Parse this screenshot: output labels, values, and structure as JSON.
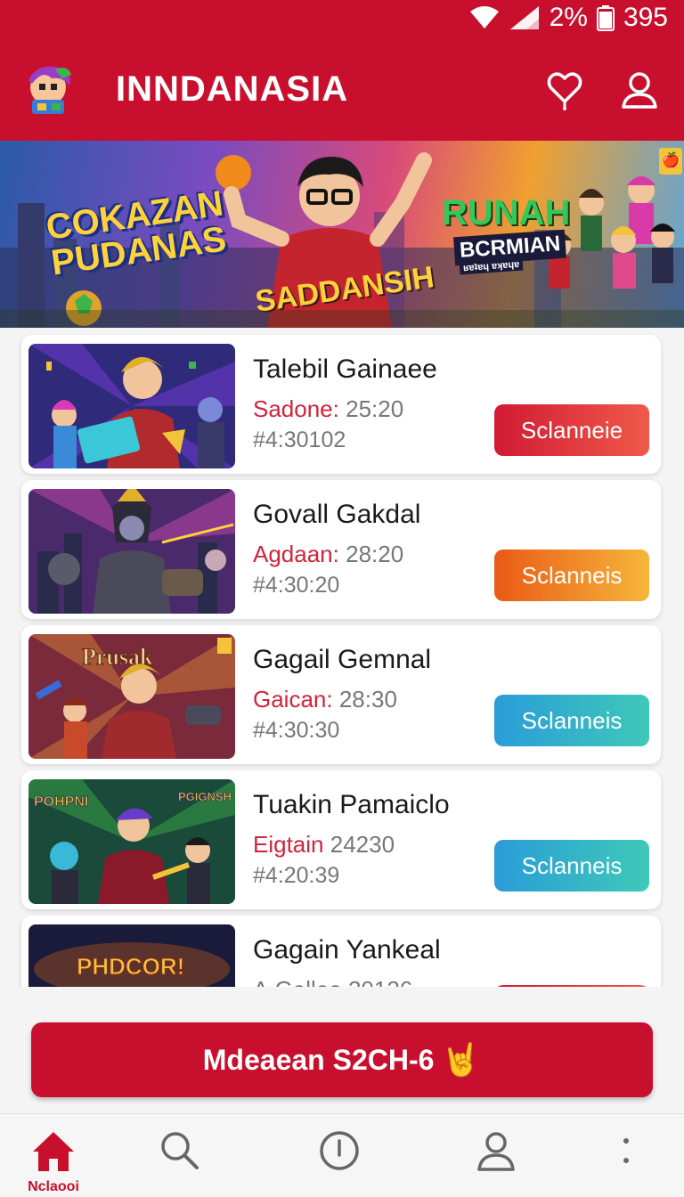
{
  "status_bar": {
    "battery": "2%",
    "time": "395"
  },
  "header": {
    "title": "INNDANASIA",
    "icons": [
      "logo-icon",
      "heart-icon",
      "user-icon"
    ]
  },
  "banner": {
    "text1_line1": "COKAZAN",
    "text1_line2": "PUDANAS",
    "text2": "SADDANSIH",
    "text3": "RUNAH",
    "text4": "BCRMIAN",
    "text5": "ʁɐʇɐɥ ɐʞɐɥɐ",
    "badge": "🍎"
  },
  "games": [
    {
      "title": "Talebil Gainaee",
      "meta_key": "Sadone:",
      "meta_val": "25:20",
      "id": "#4:30102",
      "button": "Sclanneie",
      "button_style": "red"
    },
    {
      "title": "Govall Gakdal",
      "meta_key": "Agdaan:",
      "meta_val": "28:20",
      "id": "#4:30:20",
      "button": "Sclanneis",
      "button_style": "orange"
    },
    {
      "title": "Gagail Gemnal",
      "meta_key": "Gaican:",
      "meta_val": "28:30",
      "id": "#4:30:30",
      "button": "Sclanneis",
      "button_style": "blue"
    },
    {
      "title": "Tuakin Pamaiclo",
      "meta_key": "Eigtain",
      "meta_val": "24230",
      "id": "#4:20:39",
      "button": "Sclanneis",
      "button_style": "blue"
    },
    {
      "title": "Gagain Yankeal",
      "meta_key": "A Galleo",
      "meta_val": "20126",
      "id": "",
      "button": "",
      "button_style": "red"
    }
  ],
  "thumb_texts": {
    "t3": "Prusak",
    "t4a": "POHPNI",
    "t4b": "PGIGNSH",
    "t5": "PHDCOR!"
  },
  "cta": {
    "label": "Mdeaean S2CH-6",
    "emoji": "🤘"
  },
  "bottom_nav": [
    {
      "label": "Nclaooi",
      "icon": "home-icon",
      "active": true
    },
    {
      "label": "",
      "icon": "search-icon",
      "active": false
    },
    {
      "label": "",
      "icon": "info-icon",
      "active": false
    },
    {
      "label": "",
      "icon": "profile-icon",
      "active": false
    },
    {
      "label": "",
      "icon": "more-icon",
      "active": false
    }
  ],
  "colors": {
    "brand_red": "#c8102e",
    "accent_red": "#d0243c"
  }
}
